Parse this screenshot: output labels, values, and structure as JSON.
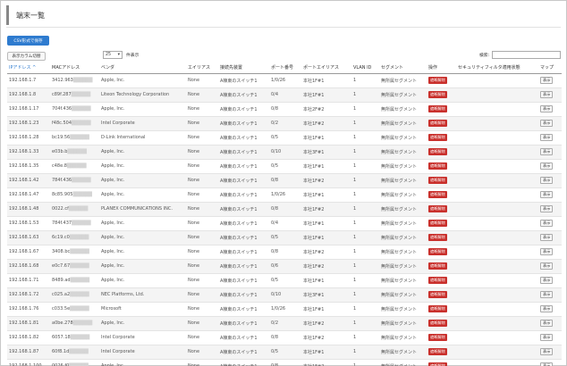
{
  "page": {
    "title": "端末一覧"
  },
  "toolbar": {
    "csv_label": "CSV形式で保存",
    "columns_label": "表示カラム切替"
  },
  "pager": {
    "page_size": "25",
    "suffix": "件表示"
  },
  "search": {
    "label": "検索:",
    "value": ""
  },
  "columns": [
    "IPアドレス",
    "MACアドレス",
    "ベンダ",
    "エイリアス",
    "接続先装置",
    "ポート番号",
    "ポートエイリアス",
    "VLAN ID",
    "セグメント",
    "操作",
    "セキュリティフィルタ適用状態",
    "マップ"
  ],
  "sort_indicator": "^",
  "mac_mask": "██████",
  "rows": [
    {
      "ip": "192.168.1.7",
      "mac": "3412.963",
      "vendor": "Apple, Inc.",
      "alias": "None",
      "device": "A棟東のスイッチ1",
      "port": "1/0/26",
      "port_alias": "本社1F#1",
      "vlan": "1",
      "segment": "無所属セグメント",
      "op": "遮断解除",
      "filter": "",
      "map": "表示"
    },
    {
      "ip": "192.168.1.8",
      "mac": "c89f.287",
      "vendor": "Liteon Technology Corporation",
      "alias": "None",
      "device": "A棟東のスイッチ1",
      "port": "0/4",
      "port_alias": "本社1F#1",
      "vlan": "1",
      "segment": "無所属セグメント",
      "op": "遮断解除",
      "filter": "",
      "map": "表示"
    },
    {
      "ip": "192.168.1.17",
      "mac": "704f.436",
      "vendor": "Apple, Inc.",
      "alias": "None",
      "device": "A棟東のスイッチ1",
      "port": "0/8",
      "port_alias": "本社2F#2",
      "vlan": "1",
      "segment": "無所属セグメント",
      "op": "遮断解除",
      "filter": "",
      "map": "表示"
    },
    {
      "ip": "192.168.1.23",
      "mac": "f48c.504",
      "vendor": "Intel Corporate",
      "alias": "None",
      "device": "A棟東のスイッチ1",
      "port": "0/2",
      "port_alias": "本社1F#2",
      "vlan": "1",
      "segment": "無所属セグメント",
      "op": "遮断解除",
      "filter": "",
      "map": "表示"
    },
    {
      "ip": "192.168.1.28",
      "mac": "bc19.56",
      "vendor": "D-Link International",
      "alias": "None",
      "device": "A棟東のスイッチ1",
      "port": "0/5",
      "port_alias": "本社1F#1",
      "vlan": "1",
      "segment": "無所属セグメント",
      "op": "遮断解除",
      "filter": "",
      "map": "表示"
    },
    {
      "ip": "192.168.1.33",
      "mac": "e03b.b",
      "vendor": "Apple, Inc.",
      "alias": "None",
      "device": "A棟東のスイッチ1",
      "port": "0/10",
      "port_alias": "本社3F#1",
      "vlan": "1",
      "segment": "無所属セグメント",
      "op": "遮断解除",
      "filter": "",
      "map": "表示"
    },
    {
      "ip": "192.168.1.35",
      "mac": "c48e.8",
      "vendor": "Apple, Inc.",
      "alias": "None",
      "device": "A棟東のスイッチ1",
      "port": "0/5",
      "port_alias": "本社1F#1",
      "vlan": "1",
      "segment": "無所属セグメント",
      "op": "遮断解除",
      "filter": "",
      "map": "表示"
    },
    {
      "ip": "192.168.1.42",
      "mac": "784f.436",
      "vendor": "Apple, Inc.",
      "alias": "None",
      "device": "A棟東のスイッチ1",
      "port": "0/8",
      "port_alias": "本社1F#2",
      "vlan": "1",
      "segment": "無所属セグメント",
      "op": "遮断解除",
      "filter": "",
      "map": "表示"
    },
    {
      "ip": "192.168.1.47",
      "mac": "8c85.905",
      "vendor": "Apple, Inc.",
      "alias": "None",
      "device": "A棟東のスイッチ1",
      "port": "1/0/26",
      "port_alias": "本社1F#1",
      "vlan": "1",
      "segment": "無所属セグメント",
      "op": "遮断解除",
      "filter": "",
      "map": "表示"
    },
    {
      "ip": "192.168.1.48",
      "mac": "0022.cf",
      "vendor": "PLANEX COMMUNICATIONS INC.",
      "alias": "None",
      "device": "A棟東のスイッチ1",
      "port": "0/8",
      "port_alias": "本社1F#2",
      "vlan": "1",
      "segment": "無所属セグメント",
      "op": "遮断解除",
      "filter": "",
      "map": "表示"
    },
    {
      "ip": "192.168.1.53",
      "mac": "784f.437",
      "vendor": "Apple, Inc.",
      "alias": "None",
      "device": "A棟東のスイッチ1",
      "port": "0/4",
      "port_alias": "本社1F#1",
      "vlan": "1",
      "segment": "無所属セグメント",
      "op": "遮断解除",
      "filter": "",
      "map": "表示"
    },
    {
      "ip": "192.168.1.63",
      "mac": "6c19.c0",
      "vendor": "Apple, Inc.",
      "alias": "None",
      "device": "A棟東のスイッチ1",
      "port": "0/5",
      "port_alias": "本社1F#1",
      "vlan": "1",
      "segment": "無所属セグメント",
      "op": "遮断解除",
      "filter": "",
      "map": "表示"
    },
    {
      "ip": "192.168.1.67",
      "mac": "3408.bc",
      "vendor": "Apple, Inc.",
      "alias": "None",
      "device": "A棟東のスイッチ1",
      "port": "0/8",
      "port_alias": "本社1F#2",
      "vlan": "1",
      "segment": "無所属セグメント",
      "op": "遮断解除",
      "filter": "",
      "map": "表示"
    },
    {
      "ip": "192.168.1.68",
      "mac": "e0c7.67",
      "vendor": "Apple, Inc.",
      "alias": "None",
      "device": "A棟東のスイッチ1",
      "port": "0/6",
      "port_alias": "本社1F#2",
      "vlan": "1",
      "segment": "無所属セグメント",
      "op": "遮断解除",
      "filter": "",
      "map": "表示"
    },
    {
      "ip": "192.168.1.71",
      "mac": "8489.ad",
      "vendor": "Apple, Inc.",
      "alias": "None",
      "device": "A棟東のスイッチ1",
      "port": "0/5",
      "port_alias": "本社1F#1",
      "vlan": "1",
      "segment": "無所属セグメント",
      "op": "遮断解除",
      "filter": "",
      "map": "表示"
    },
    {
      "ip": "192.168.1.72",
      "mac": "c025.a2",
      "vendor": "NEC Platforms, Ltd.",
      "alias": "None",
      "device": "A棟東のスイッチ1",
      "port": "0/10",
      "port_alias": "本社3F#1",
      "vlan": "1",
      "segment": "無所属セグメント",
      "op": "遮断解除",
      "filter": "",
      "map": "表示"
    },
    {
      "ip": "192.168.1.76",
      "mac": "c033.5e",
      "vendor": "Microsoft",
      "alias": "None",
      "device": "A棟東のスイッチ1",
      "port": "1/0/26",
      "port_alias": "本社1F#1",
      "vlan": "1",
      "segment": "無所属セグメント",
      "op": "遮断解除",
      "filter": "",
      "map": "表示"
    },
    {
      "ip": "192.168.1.81",
      "mac": "a0be.278",
      "vendor": "Apple, Inc.",
      "alias": "None",
      "device": "A棟東のスイッチ1",
      "port": "0/2",
      "port_alias": "本社1F#2",
      "vlan": "1",
      "segment": "無所属セグメント",
      "op": "遮断解除",
      "filter": "",
      "map": "表示"
    },
    {
      "ip": "192.168.1.82",
      "mac": "6057.18",
      "vendor": "Intel Corporate",
      "alias": "None",
      "device": "A棟東のスイッチ1",
      "port": "0/8",
      "port_alias": "本社1F#2",
      "vlan": "1",
      "segment": "無所属セグメント",
      "op": "遮断解除",
      "filter": "",
      "map": "表示"
    },
    {
      "ip": "192.168.1.87",
      "mac": "60f8.1d",
      "vendor": "Intel Corporate",
      "alias": "None",
      "device": "A棟東のスイッチ1",
      "port": "0/5",
      "port_alias": "本社1F#1",
      "vlan": "1",
      "segment": "無所属セグメント",
      "op": "遮断解除",
      "filter": "",
      "map": "表示"
    },
    {
      "ip": "192.168.1.100",
      "mac": "0026.f0",
      "vendor": "Apple, Inc.",
      "alias": "None",
      "device": "A棟東のスイッチ1",
      "port": "0/8",
      "port_alias": "本社1F#2",
      "vlan": "1",
      "segment": "無所属セグメント",
      "op": "遮断解除",
      "filter": "",
      "map": "表示"
    }
  ]
}
